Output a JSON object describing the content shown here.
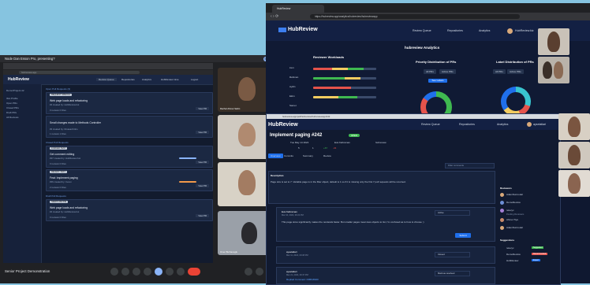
{
  "meeting": {
    "banner_text": "Node Dan Esson Pro, presenting?",
    "stop_label": "Stop presenting",
    "title": "Senior Project Demonstration",
    "address": "hubreview.app",
    "participants": [
      {
        "name": "Rachel Ahmet Sahin"
      },
      {
        "name": ""
      },
      {
        "name": ""
      },
      {
        "name": "Omer Burhanoglu"
      }
    ]
  },
  "shared_app": {
    "logo": "HubReview",
    "nav": [
      "Review Queue",
      "Repositories",
      "Analytics",
      "HubReview.mine",
      "Logout"
    ],
    "sidebar": [
      "Demo/Project-42",
      "Ibra Profile",
      "Open PRs",
      "Closed PRs",
      "Draft PRs",
      "All Reviews"
    ],
    "sections": [
      {
        "label": "Open Pull Requests (3)",
        "cards": [
          {
            "status": "REQUEST SPECIAL",
            "title": "Web page loads and refactoring",
            "meta": "#4 created by: HubReview.bot",
            "meta2": "0 reviews   0 Files"
          },
          {
            "status": "",
            "title": "Small changes made to Methods Controller",
            "meta": "#3 created by: Dinasad bikro",
            "meta2": "1 reviews   1 Files"
          }
        ]
      },
      {
        "label": "Closed Pull Requests",
        "cards": [
          {
            "status": "FORCED TEST",
            "title": "Get comment editing",
            "meta": "#37 created by: HubReview bot",
            "meta2": "0 reviews   0 Files"
          },
          {
            "status": "RECENT TEST",
            "title": "Feat: Implement paging",
            "meta": "#36 created by: Ceren",
            "meta2": "2 reviews   0 Files"
          }
        ]
      },
      {
        "label": "Draft Pull Requests",
        "cards": [
          {
            "status": "NEEDS REFINE",
            "title": "Web page loads and refactoring",
            "meta": "#4 created by: HubReview.bot",
            "meta2": "0 reviews   0 Files"
          }
        ]
      }
    ],
    "view_label": "View PR"
  },
  "browser": {
    "tab_title": "HubReview",
    "url": "https://hubreview.app/analytics/hubreview/hubreviewapp",
    "app_logo": "HubReview",
    "nav": [
      "Review Queue",
      "Repositories",
      "Analytics",
      "HubReview.kiz"
    ],
    "analytics_title": "hubreview Analytics",
    "workloads_title": "Reviewer Workloads",
    "reviewers": [
      "irem",
      "Rahman",
      "Aydin",
      "Ekim",
      "Samet"
    ],
    "priority_title": "Priority Distribution of PRs",
    "label_title": "Label Distribution of PRs",
    "filters": [
      "All PRs",
      "Active PRs"
    ],
    "see_labels": "See Labels"
  },
  "pr": {
    "popup_url": "hubreview.app/pull/hubreview/hubreviewapp/242",
    "title": "Implement paging #242",
    "state": "OPEN",
    "created_on": "Tue May 14 2024",
    "by": "Eva Kahraman",
    "project": "hubreview",
    "changes": "5",
    "commits": "1",
    "added": "+67",
    "removed": "-34",
    "tabs": [
      "Overview",
      "Commits",
      "Summary",
      "Review"
    ],
    "filter": "Filter comments",
    "desc_title": "Description",
    "description": "Page size is set to 7. Variable page is in the filter object, default is 1 so if it is missing only the first 7 pull requests will be returned.",
    "comments": [
      {
        "author": "Eva Kahraman",
        "date": "Mar 04, 2024, 09:22 PM",
        "text": "This page sizes significantly makes the renderals faster. But smaller pages mean less objects to list, I'm confused as to how to choose :)",
        "status": "Active"
      },
      {
        "author": "ayselatlari",
        "date": "Mar 11, 2024, 09:38 PM",
        "text": "",
        "status": "Closed"
      },
      {
        "author": "ayselatlari",
        "date": "Mar 21, 2024, 09:37 PM",
        "text": "Replied Comment: 038618020",
        "status": "Mark as resolved"
      }
    ],
    "submit_label": "Submit",
    "reviewers_title": "Reviewers",
    "reviewers": [
      "AdamNurmodel",
      "DemoReview",
      "relevyx",
      "Ahmet Tiye",
      "AdamNurmodel"
    ],
    "pending": "Pending Reviewers",
    "suggestions_title": "Suggestions",
    "suggestions": [
      {
        "name": "relevyx",
        "tag": "Suggested"
      },
      {
        "name": "DemoReview",
        "tag": "Recommended"
      },
      {
        "name": "HubReview",
        "tag": "Expert"
      }
    ]
  },
  "colors": {
    "accent": "#1f6feb",
    "app_bg": "#0f1830",
    "meeting_bg": "#202124",
    "desktop": "#86c4e0"
  }
}
